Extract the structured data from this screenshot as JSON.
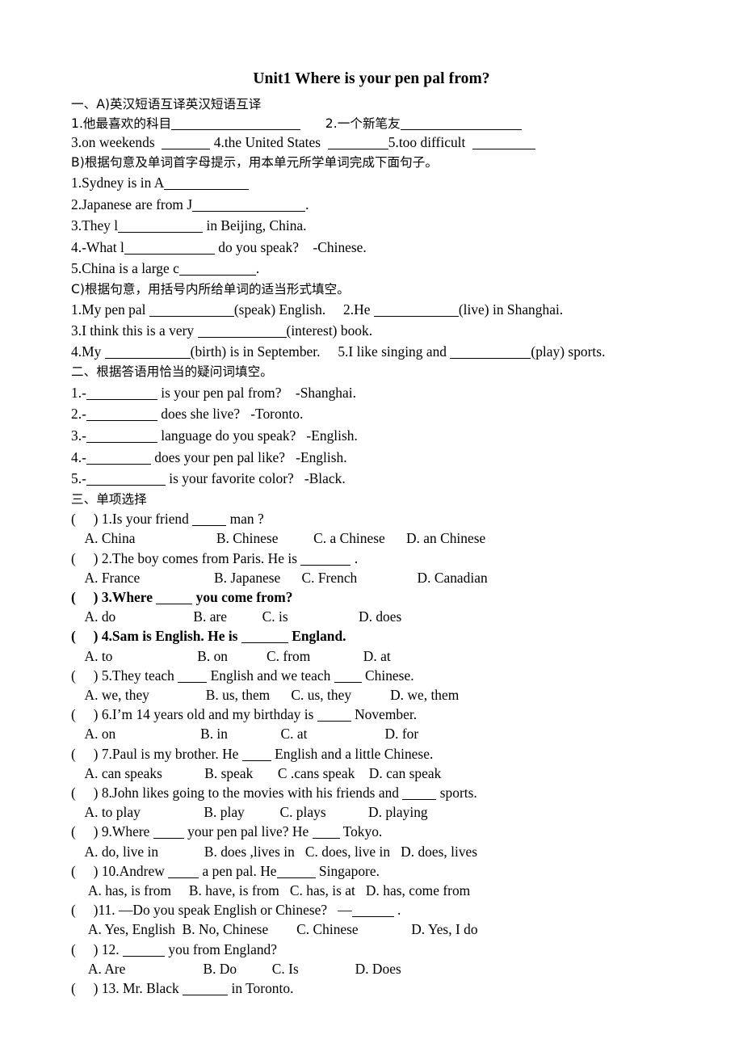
{
  "document": {
    "title": "Unit1 Where is your pen pal from?"
  },
  "section_one": {
    "heading": "一、A)英汉短语互译英汉短语互译",
    "part_a": {
      "row1": {
        "item1": "1.他最喜欢的科目",
        "item2": "2.一个新笔友"
      },
      "row2": {
        "item3": "3.on weekends",
        "item4": "4.the United States",
        "item5": "5.too difficult"
      }
    },
    "part_b": {
      "heading": "B)根据句意及单词首字母提示，用本单元所学单词完成下面句子。",
      "q1_pre": "1.Sydney is in A",
      "q1_post": "",
      "q2_pre": "2.Japanese are from J",
      "q2_post": ".",
      "q3_pre": "3.They l",
      "q3_post": " in Beijing, China.",
      "q4_pre": "4.-What l",
      "q4_post": " do you speak?    -Chinese.",
      "q5_pre": "5.China is a large c",
      "q5_post": "."
    },
    "part_c": {
      "heading": "C)根据句意，用括号内所给单词的适当形式填空。",
      "q1_pre": "1.My pen pal ",
      "q1_post": "(speak) English.",
      "q1b_pre": "2.He ",
      "q1b_post": "(live) in Shanghai.",
      "q3_pre": "3.I think this is a very ",
      "q3_post": "(interest) book.",
      "q4_pre": "4.My ",
      "q4_post": "(birth) is in September.",
      "q4b_pre": "5.I like singing and ",
      "q4b_post": "(play) sports."
    }
  },
  "section_two": {
    "heading": "二、根据答语用恰当的疑问词填空。",
    "items": [
      {
        "num": "1.-",
        "post": " is your pen pal from?    -Shanghai."
      },
      {
        "num": "2.-",
        "post": " does she live?   -Toronto."
      },
      {
        "num": "3.-",
        "post": " language do you speak?   -English."
      },
      {
        "num": "4.-",
        "post": " does your pen pal like?   -English."
      },
      {
        "num": "5.-",
        "post": " is your favorite color?   -Black."
      }
    ]
  },
  "section_three": {
    "heading": "三、单项选择",
    "questions": [
      {
        "bracket": "(     ) ",
        "bold": false,
        "stem_pre": "1.Is your friend ",
        "stem_post": " man ?",
        "options": "    A. China                       B. Chinese          C. a Chinese      D. an Chinese"
      },
      {
        "bracket": "(     ) ",
        "bold": false,
        "stem_pre": "2.The boy comes from Paris. He is ",
        "stem_post": " .",
        "options": "    A. France                     B. Japanese      C. French                 D. Canadian"
      },
      {
        "bracket": "(     ) ",
        "bold": true,
        "stem_pre": "3.Where ",
        "stem_post": " you come from?",
        "options": "    A. do                      B. are          C. is                    D. does"
      },
      {
        "bracket": "(     ) ",
        "bold": true,
        "stem_pre": "4.Sam is English. He is ",
        "stem_post": " England.",
        "options": "    A. to                        B. on           C. from               D. at"
      },
      {
        "bracket": "(     ) ",
        "bold": false,
        "stem_pre": "5.They teach ",
        "stem_mid": " English and we teach ",
        "stem_post": " Chinese.",
        "options": "    A. we, they                B. us, them      C. us, they           D. we, them"
      },
      {
        "bracket": "(     ) ",
        "bold": false,
        "stem_pre": "6.I’m 14 years old and my birthday is ",
        "stem_post": " November.",
        "options": "    A. on                        B. in               C. at                      D. for"
      },
      {
        "bracket": "(     ) ",
        "bold": false,
        "stem_pre": "7.Paul is my brother. He ",
        "stem_post": " English and a little Chinese.",
        "options": "    A. can speaks            B. speak       C .cans speak    D. can speak"
      },
      {
        "bracket": "(     ) ",
        "bold": false,
        "stem_pre": "8.John likes going to the movies with his friends and ",
        "stem_post": " sports.",
        "options": "    A. to play                  B. play          C. plays            D. playing"
      },
      {
        "bracket": "(     ) ",
        "bold": false,
        "stem_pre": "9.Where ",
        "stem_mid": " your pen pal live? He ",
        "stem_post": " Tokyo.",
        "options": "    A. do, live in             B. does ,lives in   C. does, live in   D. does, lives"
      },
      {
        "bracket": "(     ) ",
        "bold": false,
        "stem_pre": "10.Andrew ",
        "stem_mid": " a pen pal. He",
        "stem_post": " Singapore.",
        "options": "     A. has, is from     B. have, is from   C. has, is at   D. has, come from"
      },
      {
        "bracket": "(     )",
        "bold": false,
        "stem_pre": "11. —Do you speak English or Chinese?   —",
        "stem_post": " .",
        "options": "     A. Yes, English  B. No, Chinese        C. Chinese               D. Yes, I do"
      },
      {
        "bracket": "(     ) ",
        "bold": false,
        "stem_pre": "12. ",
        "stem_post": " you from England?",
        "options": "     A. Are                      B. Do          C. Is                D. Does"
      },
      {
        "bracket": "(     ) ",
        "bold": false,
        "stem_pre": "13. Mr. Black ",
        "stem_post": " in Toronto.",
        "options": ""
      }
    ]
  }
}
